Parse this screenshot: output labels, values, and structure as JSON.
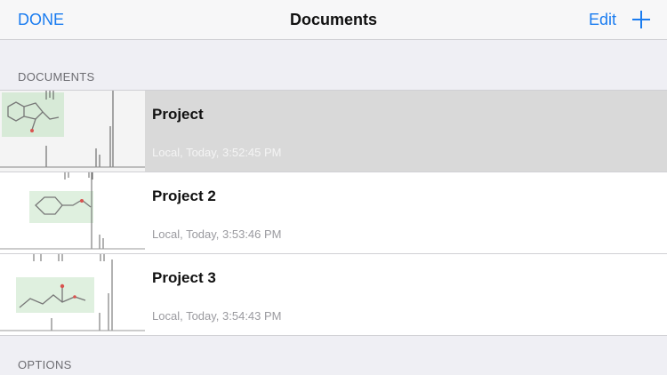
{
  "nav": {
    "done_label": "DONE",
    "title": "Documents",
    "edit_label": "Edit",
    "add_icon": "plus-icon"
  },
  "sections": {
    "documents_header": "DOCUMENTS",
    "options_header": "OPTIONS"
  },
  "documents": [
    {
      "title": "Project",
      "subtitle": "Local, Today, 3:52:45 PM",
      "selected": true
    },
    {
      "title": "Project 2",
      "subtitle": "Local, Today, 3:53:46 PM",
      "selected": false
    },
    {
      "title": "Project 3",
      "subtitle": "Local, Today, 3:54:43 PM",
      "selected": false
    }
  ],
  "colors": {
    "accent": "#1a7cf0",
    "selected_row": "#d9d9d9",
    "background": "#efeff4"
  }
}
